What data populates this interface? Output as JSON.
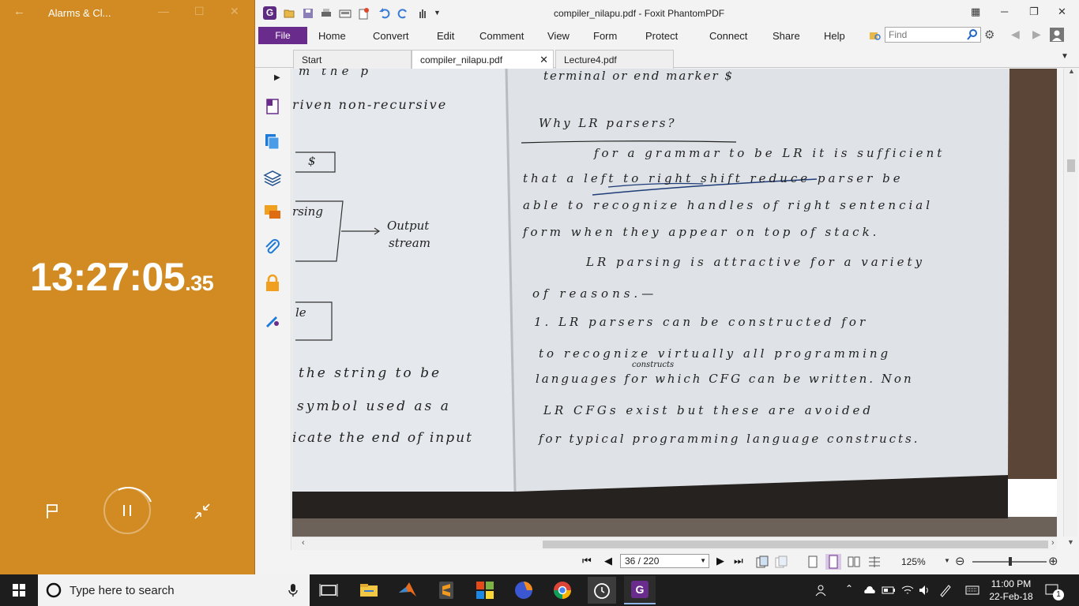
{
  "clock_app": {
    "title": "Alarms & Cl...",
    "time_main": "13:27:05",
    "time_fraction": ".35"
  },
  "foxit": {
    "window_title": "compiler_nilapu.pdf - Foxit PhantomPDF",
    "file_tab": "File",
    "menu": [
      "Home",
      "Convert",
      "Edit",
      "Comment",
      "View",
      "Form",
      "Protect",
      "Connect",
      "Share",
      "Help"
    ],
    "find_placeholder": "Find",
    "tabs": [
      {
        "label": "Start",
        "active": false
      },
      {
        "label": "compiler_nilapu.pdf",
        "active": true
      },
      {
        "label": "Lecture4.pdf",
        "active": false
      }
    ],
    "page_indicator": "36 / 220",
    "zoom": "125%",
    "accent_color": "#6a2c8c"
  },
  "page_content": {
    "left_page_lines": [
      "m the p",
      "riven non-recursive",
      "$",
      "rsing",
      "Output",
      "stream",
      "le",
      "the string to be",
      "symbol used as a",
      "icate the end of input"
    ],
    "right_page_lines": [
      "terminal or end marker $",
      "Why LR parsers?",
      "for a grammar to be LR it is sufficient",
      "that a left to right shift reduce parser be",
      "able to recognize handles of right sentencial",
      "form when they appear on top of stack.",
      "LR parsing is attractive for a variety",
      "of reasons.—",
      "1. LR parsers can be constructed for",
      "to recognize virtually all programming",
      "constructs",
      "languages for which CFG can be written. Non",
      "LR CFGs exist but these are avoided",
      "for typical programming language constructs."
    ]
  },
  "taskbar": {
    "search_placeholder": "Type here to search",
    "time": "11:00 PM",
    "date": "22-Feb-18",
    "notification_count": "1"
  }
}
